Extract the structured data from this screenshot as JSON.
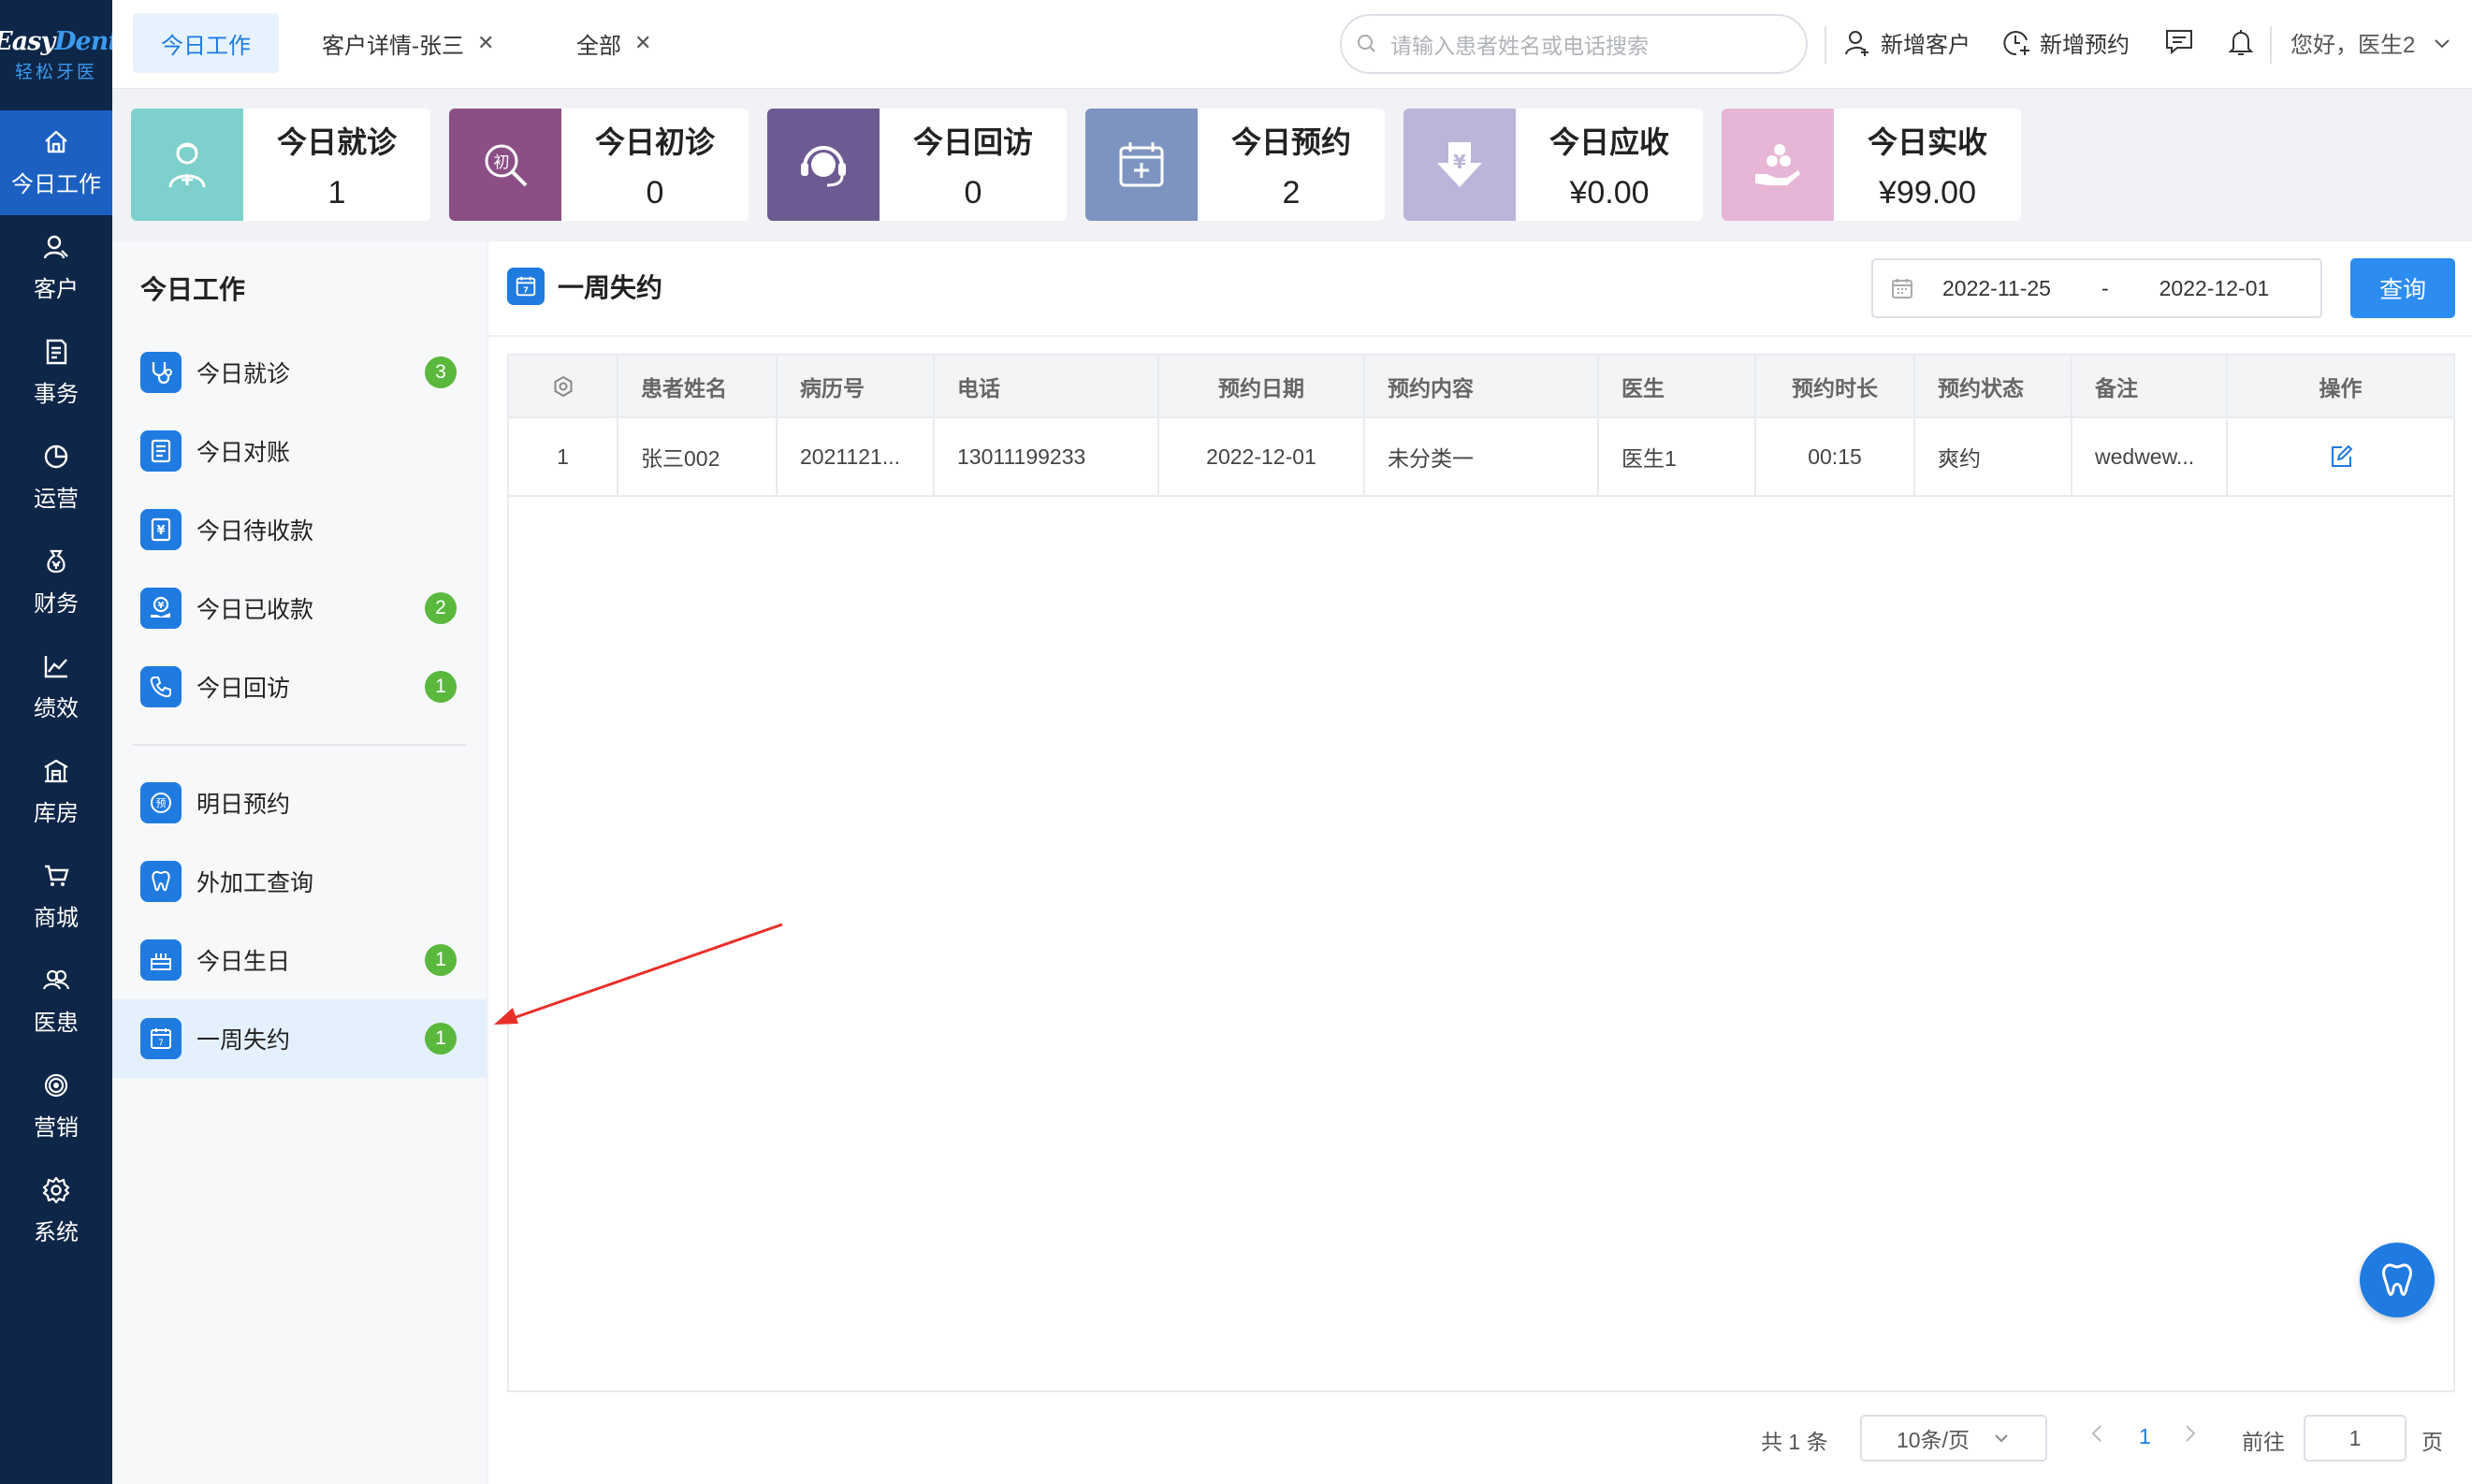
{
  "brand": {
    "logo_text_1": "Easy",
    "logo_text_2": "Dent",
    "logo_cn": "轻松牙医"
  },
  "nav": {
    "items": [
      {
        "label": "今日工作",
        "icon": "home-icon"
      },
      {
        "label": "客户",
        "icon": "user-icon"
      },
      {
        "label": "事务",
        "icon": "document-icon"
      },
      {
        "label": "运营",
        "icon": "pie-chart-icon"
      },
      {
        "label": "财务",
        "icon": "money-bag-icon"
      },
      {
        "label": "绩效",
        "icon": "line-chart-icon"
      },
      {
        "label": "库房",
        "icon": "warehouse-icon"
      },
      {
        "label": "商城",
        "icon": "cart-icon"
      },
      {
        "label": "医患",
        "icon": "people-icon"
      },
      {
        "label": "营销",
        "icon": "target-icon"
      },
      {
        "label": "系统",
        "icon": "gear-icon"
      }
    ],
    "active": 0
  },
  "tabs": [
    {
      "label": "今日工作",
      "closable": false
    },
    {
      "label": "客户详情-张三",
      "closable": true
    },
    {
      "label": "全部",
      "closable": true
    }
  ],
  "topbar": {
    "search_placeholder": "请输入患者姓名或电话搜索",
    "add_customer": "新增客户",
    "add_appointment": "新增预约",
    "greeting": "您好，医生2"
  },
  "stats": [
    {
      "title": "今日就诊",
      "value": "1",
      "color": "#7ed0cc",
      "icon": "doctor-icon"
    },
    {
      "title": "今日初诊",
      "value": "0",
      "color": "#8b4f86",
      "icon": "first-visit-icon"
    },
    {
      "title": "今日回访",
      "value": "0",
      "color": "#6e5a92",
      "icon": "headset-icon"
    },
    {
      "title": "今日预约",
      "value": "2",
      "color": "#7d94c0",
      "icon": "calendar-plus-icon"
    },
    {
      "title": "今日应收",
      "value": "¥0.00",
      "color": "#bbb5d9",
      "icon": "yuan-down-icon"
    },
    {
      "title": "今日实收",
      "value": "¥99.00",
      "color": "#e7b6d6",
      "icon": "hand-coins-icon"
    }
  ],
  "submenu": {
    "title": "今日工作",
    "items": [
      {
        "label": "今日就诊",
        "badge": "3",
        "icon": "stethoscope-icon"
      },
      {
        "label": "今日对账",
        "badge": "",
        "icon": "ledger-icon"
      },
      {
        "label": "今日待收款",
        "badge": "",
        "icon": "pending-payment-icon"
      },
      {
        "label": "今日已收款",
        "badge": "2",
        "icon": "received-payment-icon"
      },
      {
        "label": "今日回访",
        "badge": "1",
        "icon": "phone-icon"
      },
      {
        "label": "明日预约",
        "badge": "",
        "icon": "appointment-icon"
      },
      {
        "label": "外加工查询",
        "badge": "",
        "icon": "tooth-icon"
      },
      {
        "label": "今日生日",
        "badge": "1",
        "icon": "cake-icon"
      },
      {
        "label": "一周失约",
        "badge": "1",
        "icon": "calendar-7-icon"
      }
    ],
    "active": 8
  },
  "main": {
    "title": "一周失约",
    "date_start": "2022-11-25",
    "date_sep": "-",
    "date_end": "2022-12-01",
    "query_label": "查询",
    "table": {
      "headers": [
        "",
        "患者姓名",
        "病历号",
        "电话",
        "预约日期",
        "预约内容",
        "医生",
        "预约时长",
        "预约状态",
        "备注",
        "操作"
      ],
      "rows": [
        [
          "1",
          "张三002",
          "2021121...",
          "13011199233",
          "2022-12-01",
          "未分类一",
          "医生1",
          "00:15",
          "爽约",
          "wedwew...",
          ""
        ]
      ]
    }
  },
  "pagination": {
    "total": "共 1 条",
    "page_size": "10条/页",
    "current": "1",
    "goto_label": "前往",
    "goto_value": "1",
    "page_suffix": "页"
  },
  "colors": {
    "accent": "#1f7be0",
    "nav_bg": "#0e2647",
    "badge": "#5ab83c",
    "annotation_arrow": "#e8302a"
  }
}
